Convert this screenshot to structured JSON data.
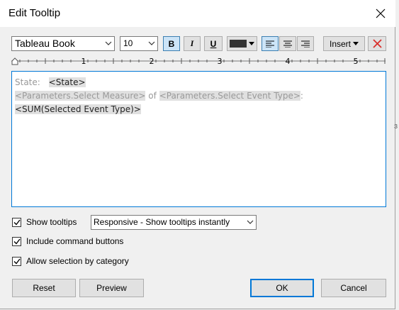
{
  "window": {
    "title": "Edit Tooltip"
  },
  "toolbar": {
    "font_family": "Tableau Book",
    "font_size": "10",
    "bold_label": "B",
    "italic_label": "I",
    "underline_label": "U",
    "text_color": "#333333",
    "insert_label": "Insert",
    "clear_icon": "red-x-icon"
  },
  "ruler": {
    "numbers": [
      "1",
      "2",
      "3",
      "4",
      "5"
    ]
  },
  "editor": {
    "line1_label": "State:",
    "line1_field": "<State>",
    "line2_field1": "<Parameters.Select Measure>",
    "line2_of": "of",
    "line2_field2": "<Parameters.Select Event Type>",
    "line2_colon": ":",
    "line3_field": "<SUM(Selected Event Type)>"
  },
  "options": {
    "show_tooltips": {
      "label": "Show tooltips",
      "checked": true
    },
    "tooltip_mode": "Responsive - Show tooltips instantly",
    "include_command_buttons": {
      "label": "Include command buttons",
      "checked": true
    },
    "allow_selection": {
      "label": "Allow selection by category",
      "checked": true
    }
  },
  "buttons": {
    "reset": "Reset",
    "preview": "Preview",
    "ok": "OK",
    "cancel": "Cancel"
  }
}
